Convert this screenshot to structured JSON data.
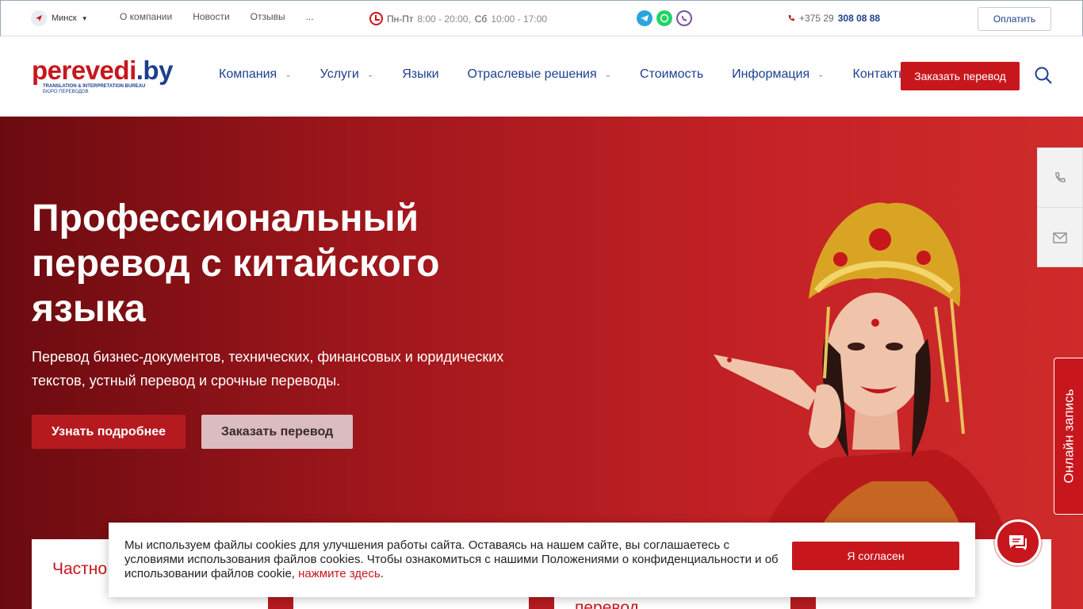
{
  "topbar": {
    "city": "Минск",
    "links": [
      "О компании",
      "Новости",
      "Отзывы",
      "..."
    ],
    "hours_days1": "Пн-Пт",
    "hours_time1": "8:00 - 20:00,",
    "hours_days2": "Сб",
    "hours_time2": "10:00 - 17:00",
    "phone_prefix": "+375 29",
    "phone_number": "308 08 88",
    "pay_label": "Оплатить"
  },
  "logo": {
    "name_a": "perevedi",
    "name_b": ".by",
    "tagline1": "TRANSLATION & INTERPRETATION BUREAU",
    "tagline2": "БЮРО ПЕРЕВОДОВ"
  },
  "nav": {
    "items": [
      {
        "label": "Компания",
        "has_dropdown": true
      },
      {
        "label": "Услуги",
        "has_dropdown": true
      },
      {
        "label": "Языки",
        "has_dropdown": false
      },
      {
        "label": "Отраслевые решения",
        "has_dropdown": true
      },
      {
        "label": "Стоимость",
        "has_dropdown": false
      },
      {
        "label": "Информация",
        "has_dropdown": true
      },
      {
        "label": "Контакты",
        "has_dropdown": false
      }
    ],
    "order_label": "Заказать перевод"
  },
  "hero": {
    "title": "Профессиональный перевод с китайского языка",
    "subtitle": "Перевод бизнес-документов, технических, финансовых и юридических текстов, устный перевод и срочные переводы.",
    "more_label": "Узнать подробнее",
    "order_label": "Заказать перевод"
  },
  "side": {
    "online_label": "Онлайн запись"
  },
  "cards": {
    "card1_title": "Частно... клиенту...",
    "card3_title": "перевод"
  },
  "cookie": {
    "text": "Мы используем файлы cookies для улучшения работы сайта. Оставаясь на нашем сайте, вы соглашаетесь с условиями использования файлов cookies. Чтобы ознакомиться с нашими Положениями о конфиденциальности и об использовании файлов cookie, ",
    "link": "нажмите здесь",
    "after": ".",
    "agree_label": "Я согласен"
  },
  "colors": {
    "brand_red": "#c8161d",
    "brand_blue": "#1d3f8f"
  }
}
